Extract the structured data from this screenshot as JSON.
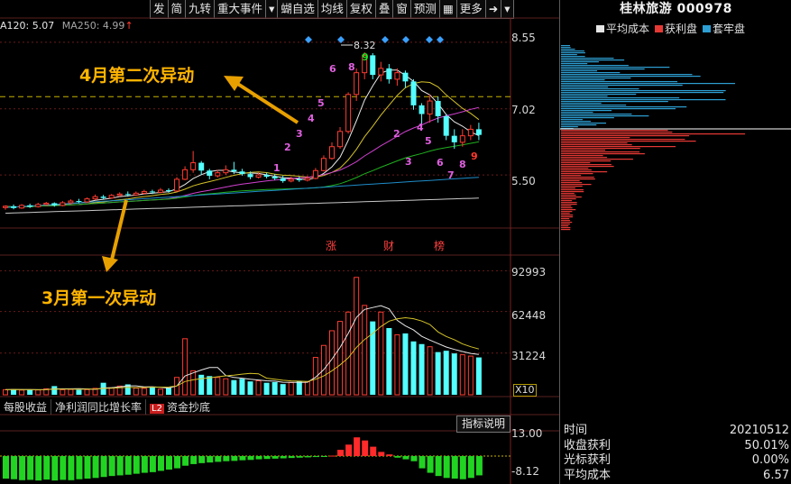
{
  "toolbar": {
    "items": [
      "发",
      "简",
      "九转",
      "重大事件",
      "",
      "蝴自选",
      "均线",
      "复权",
      "叠",
      "窗",
      "预测",
      "",
      "更多",
      "",
      ""
    ]
  },
  "indicators": {
    "ma120_label": "A120: 5.07",
    "ma250_label": "MA250: 4.99",
    "up_arrow": "↑"
  },
  "price_axis": {
    "labels": [
      "8.55",
      "7.02",
      "5.50"
    ]
  },
  "volume_axis": {
    "labels": [
      "92993",
      "62448",
      "31224"
    ],
    "multiplier": "X10"
  },
  "macd_axis": {
    "labels": [
      "13.00",
      "-8.12"
    ]
  },
  "annotations": {
    "second_move": "4月第二次异动",
    "first_move": "3月第一次异动",
    "peak_price": "8.32"
  },
  "event_markers": [
    "涨",
    "财",
    "榜"
  ],
  "bottom_tabs": [
    "每股收益",
    "净利润同比增长率",
    "资金抄底"
  ],
  "l2_badge": "L2",
  "indicator_button": "指标说明",
  "right_panel": {
    "title": "桂林旅游 000978",
    "legend": [
      {
        "label": "平均成本",
        "color": "#e6e6e6"
      },
      {
        "label": "获利盘",
        "color": "#e53935"
      },
      {
        "label": "套牢盘",
        "color": "#2d9fd3"
      }
    ],
    "info": [
      {
        "label": "时间",
        "value": "20210512"
      },
      {
        "label": "收盘获利",
        "value": "50.01%"
      },
      {
        "label": "光标获利",
        "value": "0.00%"
      },
      {
        "label": "平均成本",
        "value": "6.57"
      }
    ]
  },
  "chart_data": [
    {
      "type": "candlestick",
      "ylim": [
        4.3,
        8.9
      ],
      "y_ticks": [
        8.55,
        7.02,
        5.5
      ],
      "peak_annotation": "8.32",
      "candles": [
        [
          4.75,
          4.78,
          4.7,
          4.8
        ],
        [
          4.78,
          4.74,
          4.71,
          4.82
        ],
        [
          4.74,
          4.8,
          4.72,
          4.83
        ],
        [
          4.8,
          4.77,
          4.74,
          4.84
        ],
        [
          4.77,
          4.82,
          4.75,
          4.86
        ],
        [
          4.82,
          4.85,
          4.79,
          4.88
        ],
        [
          4.85,
          4.8,
          4.77,
          4.87
        ],
        [
          4.8,
          4.86,
          4.78,
          4.9
        ],
        [
          4.86,
          4.9,
          4.83,
          4.94
        ],
        [
          4.9,
          4.88,
          4.85,
          4.95
        ],
        [
          4.88,
          4.95,
          4.86,
          4.98
        ],
        [
          4.95,
          5.0,
          4.92,
          5.05
        ],
        [
          5.0,
          4.97,
          4.94,
          5.04
        ],
        [
          4.97,
          5.03,
          4.95,
          5.06
        ],
        [
          5.03,
          5.06,
          5.0,
          5.1
        ],
        [
          5.06,
          5.04,
          5.0,
          5.12
        ],
        [
          5.04,
          5.08,
          5.02,
          5.12
        ],
        [
          5.08,
          5.12,
          5.05,
          5.16
        ],
        [
          5.12,
          5.1,
          5.06,
          5.16
        ],
        [
          5.1,
          5.15,
          5.08,
          5.2
        ],
        [
          5.15,
          5.13,
          5.09,
          5.19
        ],
        [
          5.13,
          5.4,
          5.12,
          5.45
        ],
        [
          5.4,
          5.62,
          5.38,
          5.7
        ],
        [
          5.62,
          5.78,
          5.55,
          6.05
        ],
        [
          5.78,
          5.6,
          5.5,
          5.82
        ],
        [
          5.6,
          5.48,
          5.4,
          5.64
        ],
        [
          5.48,
          5.55,
          5.44,
          5.62
        ],
        [
          5.55,
          5.62,
          5.5,
          5.72
        ],
        [
          5.62,
          5.58,
          5.52,
          5.8
        ],
        [
          5.58,
          5.52,
          5.48,
          5.64
        ],
        [
          5.52,
          5.45,
          5.4,
          5.58
        ],
        [
          5.45,
          5.5,
          5.42,
          5.56
        ],
        [
          5.5,
          5.46,
          5.42,
          5.55
        ],
        [
          5.46,
          5.42,
          5.38,
          5.52
        ],
        [
          5.42,
          5.36,
          5.32,
          5.48
        ],
        [
          5.36,
          5.4,
          5.33,
          5.46
        ],
        [
          5.4,
          5.38,
          5.34,
          5.46
        ],
        [
          5.38,
          5.42,
          5.35,
          5.48
        ],
        [
          5.42,
          5.6,
          5.4,
          5.66
        ],
        [
          5.6,
          5.88,
          5.58,
          5.95
        ],
        [
          5.88,
          6.15,
          5.85,
          6.25
        ],
        [
          6.15,
          6.5,
          6.1,
          6.6
        ],
        [
          6.5,
          7.35,
          6.45,
          7.4
        ],
        [
          7.35,
          7.85,
          7.2,
          7.95
        ],
        [
          7.85,
          8.25,
          7.7,
          8.32
        ],
        [
          8.25,
          7.8,
          7.7,
          8.3
        ],
        [
          7.8,
          7.95,
          7.65,
          8.1
        ],
        [
          7.95,
          7.7,
          7.6,
          8.05
        ],
        [
          7.7,
          7.85,
          7.55,
          7.95
        ],
        [
          7.85,
          7.65,
          7.5,
          7.9
        ],
        [
          7.65,
          7.1,
          7.0,
          7.7
        ],
        [
          7.1,
          6.9,
          6.6,
          7.15
        ],
        [
          6.9,
          7.2,
          6.7,
          7.35
        ],
        [
          7.2,
          6.85,
          6.7,
          7.3
        ],
        [
          6.85,
          6.4,
          6.3,
          6.9
        ],
        [
          6.4,
          6.25,
          6.1,
          6.55
        ],
        [
          6.25,
          6.4,
          6.15,
          6.55
        ],
        [
          6.4,
          6.55,
          6.3,
          6.65
        ],
        [
          6.55,
          6.42,
          6.3,
          6.7
        ]
      ],
      "countdown_labels": [
        "1",
        "2",
        "3",
        "4",
        "5",
        "6",
        "8",
        "9",
        "2",
        "3",
        "4",
        "5",
        "6",
        "7",
        "8",
        "9"
      ]
    },
    {
      "type": "bar",
      "title": "volume",
      "ylim": [
        0,
        100000
      ],
      "y_ticks": [
        92993,
        62448,
        31224
      ],
      "values": [
        3800,
        4200,
        3500,
        3900,
        3600,
        4500,
        6500,
        3800,
        4000,
        3700,
        3900,
        4800,
        9000,
        5200,
        6500,
        7800,
        5000,
        4800,
        6000,
        4200,
        5000,
        13000,
        42000,
        18000,
        15000,
        14000,
        13000,
        12000,
        11000,
        12000,
        10000,
        10500,
        9000,
        9500,
        8000,
        9200,
        10500,
        9800,
        28000,
        37000,
        48000,
        55000,
        62000,
        88000,
        67000,
        55000,
        62000,
        50000,
        45000,
        46000,
        40000,
        38000,
        36000,
        32000,
        33000,
        31000,
        30000,
        29000,
        28000
      ]
    },
    {
      "type": "bar",
      "title": "macd",
      "ylim": [
        -8.12,
        13.0
      ],
      "y_ticks": [
        13.0,
        -8.12
      ],
      "values": [
        -7,
        -7.2,
        -7.5,
        -7.4,
        -7.6,
        -7.3,
        -7.6,
        -7.4,
        -7.5,
        -7.2,
        -7.0,
        -6.8,
        -6.5,
        -6.2,
        -6.0,
        -5.8,
        -5.5,
        -5.2,
        -5.0,
        -4.6,
        -4.2,
        -3.8,
        -3.0,
        -2.5,
        -2.2,
        -2.0,
        -1.8,
        -1.6,
        -1.5,
        -1.3,
        -1.2,
        -1.0,
        -0.9,
        -0.8,
        -0.7,
        -0.6,
        -0.5,
        -0.4,
        -0.3,
        -0.2,
        0.2,
        3,
        5.5,
        9,
        7.5,
        4.5,
        2,
        0.8,
        -0.5,
        -1,
        -1.6,
        -3.8,
        -5.2,
        -6.2,
        -6.8,
        -7.0,
        -7.2,
        -6.8,
        -6.0
      ]
    }
  ]
}
